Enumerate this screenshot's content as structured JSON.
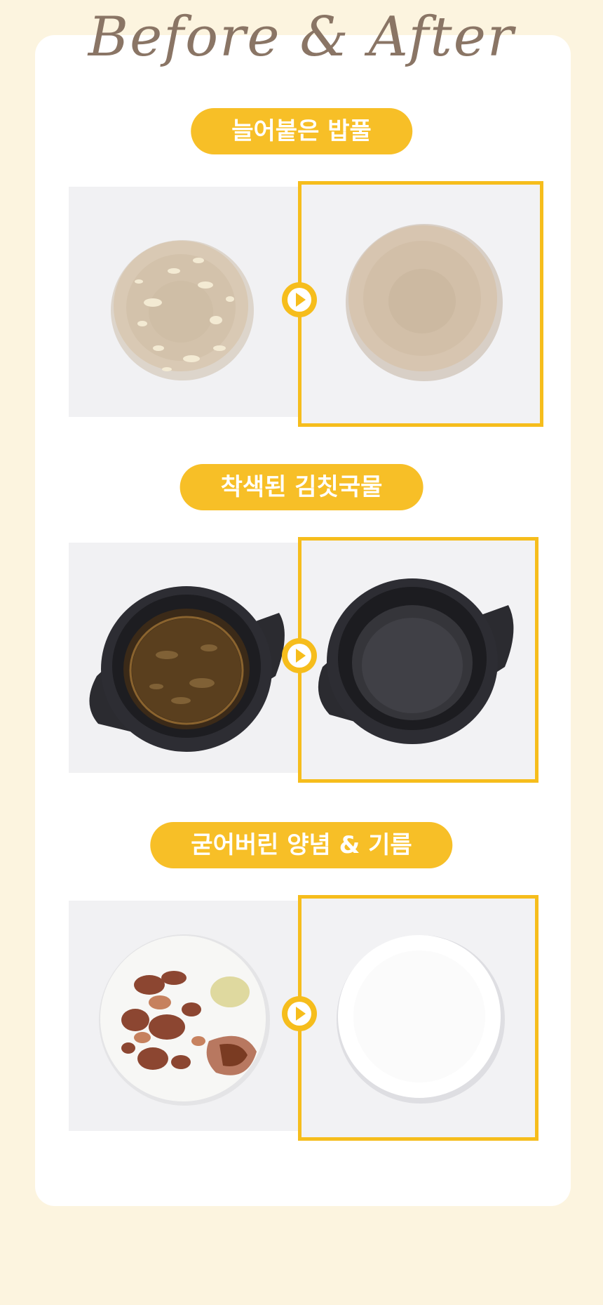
{
  "header": {
    "title": "Before & After"
  },
  "colors": {
    "accent": "#f6bd1c",
    "page_background": "#fcf4df",
    "card_background": "#ffffff",
    "title_color": "#8a7565"
  },
  "sections": [
    {
      "label": "늘어붙은 밥풀",
      "before_image": "dirty beige bowl with dried rice",
      "after_image": "clean beige bowl"
    },
    {
      "label": "착색된 김칫국물",
      "before_image": "black pot stained with kimchi soup",
      "after_image": "clean black pot"
    },
    {
      "label": "굳어버린 양념 & 기름",
      "before_image": "white plate with dried sauce and oil",
      "after_image": "clean white plate"
    }
  ],
  "icons": {
    "arrow": "play-arrow-icon"
  }
}
